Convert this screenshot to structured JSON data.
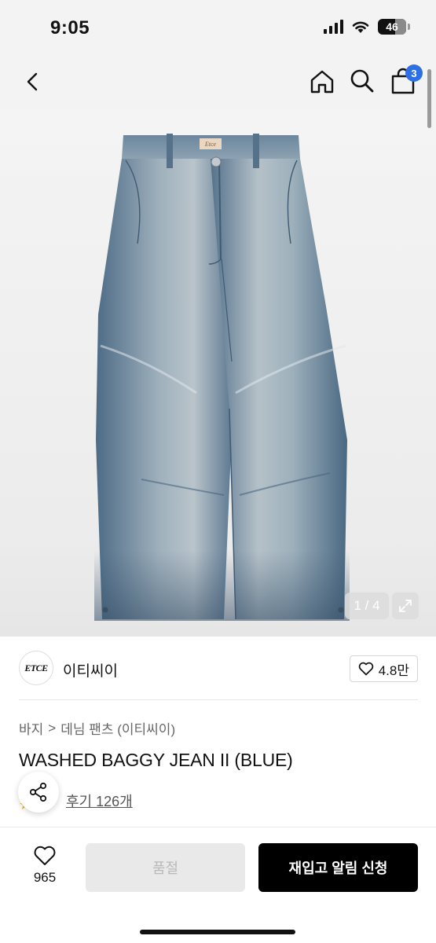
{
  "status_bar": {
    "time": "9:05",
    "battery": "46"
  },
  "nav": {
    "cart_count": "3"
  },
  "gallery": {
    "counter": "1 / 4",
    "brand_tag": "Etce"
  },
  "brand": {
    "logo_text": "ETCE",
    "name": "이티씨이",
    "likes": "4.8만"
  },
  "breadcrumb": {
    "category": "바지",
    "separator": ">",
    "subcategory": "데님 팬츠 (이티씨이)"
  },
  "product": {
    "title": "WASHED BAGGY JEAN II (BLUE)",
    "reviews": "후기 126개"
  },
  "bottom_bar": {
    "wish_count": "965",
    "soldout_label": "품절",
    "restock_label": "재입고 알림 신청"
  },
  "colors": {
    "accent_badge": "#2f6fe4",
    "denim": "#5b7893",
    "primary_button": "#000000"
  },
  "icons": [
    "back-icon",
    "home-icon",
    "search-icon",
    "cart-icon",
    "expand-icon",
    "heart-icon",
    "share-icon",
    "star-icon"
  ]
}
